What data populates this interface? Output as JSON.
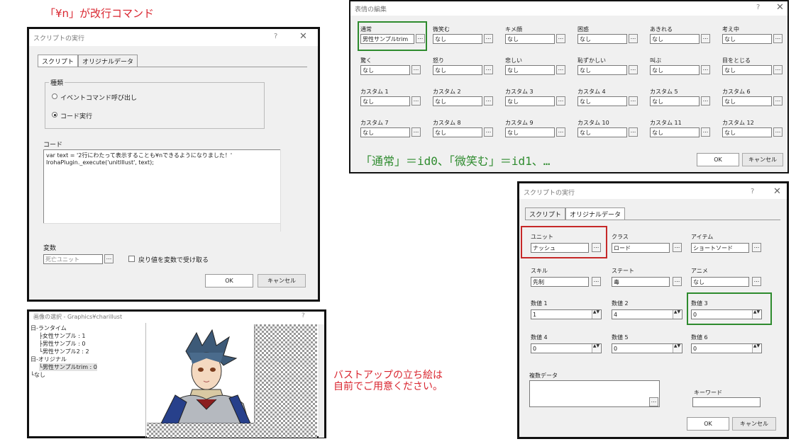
{
  "notes": {
    "top_left": "「¥n」が改行コマンド",
    "ids": "「通常」＝id0、「微笑む」＝id1、…",
    "bustup": [
      "バストアップの立ち絵は",
      "自前でご用意ください。"
    ]
  },
  "script_dialog1": {
    "title": "スクリプトの実行",
    "help": "?",
    "close": "✕",
    "tabs": [
      "スクリプト",
      "オリジナルデータ"
    ],
    "group_label": "種類",
    "radio1": "イベントコマンド呼び出し",
    "radio2": "コード実行",
    "code_label": "コード",
    "code_lines": [
      "var text = '2行にわたって表示することも¥nできるようになりました！'",
      "IrohaPlugin._execute('unitIllust', text);"
    ],
    "var_label": "変数",
    "var_value": "死亡ユニット",
    "dots": "...",
    "checkbox_label": "戻り値を変数で受け取る",
    "ok": "OK",
    "cancel": "キャンセル"
  },
  "expression_dialog": {
    "title": "表情の編集",
    "help": "?",
    "close": "✕",
    "fields": [
      {
        "label": "通常",
        "value": "男性サンプルtrim"
      },
      {
        "label": "微笑む",
        "value": "なし"
      },
      {
        "label": "キメ顔",
        "value": "なし"
      },
      {
        "label": "困惑",
        "value": "なし"
      },
      {
        "label": "あきれる",
        "value": "なし"
      },
      {
        "label": "考え中",
        "value": "なし"
      },
      {
        "label": "驚く",
        "value": "なし"
      },
      {
        "label": "怒り",
        "value": "なし"
      },
      {
        "label": "悲しい",
        "value": "なし"
      },
      {
        "label": "恥ずかしい",
        "value": "なし"
      },
      {
        "label": "叫ぶ",
        "value": "なし"
      },
      {
        "label": "目をとじる",
        "value": "なし"
      },
      {
        "label": "カスタム 1",
        "value": "なし"
      },
      {
        "label": "カスタム 2",
        "value": "なし"
      },
      {
        "label": "カスタム 3",
        "value": "なし"
      },
      {
        "label": "カスタム 4",
        "value": "なし"
      },
      {
        "label": "カスタム 5",
        "value": "なし"
      },
      {
        "label": "カスタム 6",
        "value": "なし"
      },
      {
        "label": "カスタム 7",
        "value": "なし"
      },
      {
        "label": "カスタム 8",
        "value": "なし"
      },
      {
        "label": "カスタム 9",
        "value": "なし"
      },
      {
        "label": "カスタム 10",
        "value": "なし"
      },
      {
        "label": "カスタム 11",
        "value": "なし"
      },
      {
        "label": "カスタム 12",
        "value": "なし"
      }
    ],
    "dots": "...",
    "ok": "OK",
    "cancel": "キャンセル"
  },
  "image_dialog": {
    "title": "画像の選択 - Graphics¥charillust",
    "help": "?",
    "tree": [
      "日-ランタイム",
      "├女性サンプル : 1",
      "├男性サンプル : 0",
      "└男性サンプル2 : 2",
      "日-オリジナル",
      "└男性サンプルtrim : 0",
      "└なし"
    ]
  },
  "script_dialog2": {
    "title": "スクリプトの実行",
    "help": "?",
    "close": "✕",
    "tabs": [
      "スクリプト",
      "オリジナルデータ"
    ],
    "fields": [
      {
        "label": "ユニット",
        "value": "ナッシュ"
      },
      {
        "label": "クラス",
        "value": "ロード"
      },
      {
        "label": "アイテム",
        "value": "ショートソード"
      },
      {
        "label": "スキル",
        "value": "先制"
      },
      {
        "label": "ステート",
        "value": "毒"
      },
      {
        "label": "アニメ",
        "value": "なし"
      }
    ],
    "numbers": [
      {
        "label": "数値 1",
        "value": "1"
      },
      {
        "label": "数値 2",
        "value": "4"
      },
      {
        "label": "数値 3",
        "value": "0"
      },
      {
        "label": "数値 4",
        "value": "0"
      },
      {
        "label": "数値 5",
        "value": "0"
      },
      {
        "label": "数値 6",
        "value": "0"
      }
    ],
    "multi_label": "複数データ",
    "keyword_label": "キーワード",
    "dots": "...",
    "ok": "OK",
    "cancel": "キャンセル"
  },
  "colors": {
    "note_red": "#d9252f",
    "note_green": "#2e8b2e",
    "highlight_red": "#c62828"
  }
}
